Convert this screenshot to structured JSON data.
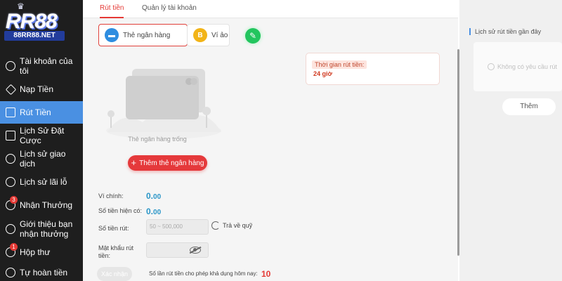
{
  "brand": {
    "logo_text": "RR88",
    "site": "88RR88.NET"
  },
  "sidebar": {
    "items": [
      {
        "label": "Tài khoản của tôi",
        "icon": "account-icon"
      },
      {
        "label": "Nạp Tiền",
        "icon": "deposit-icon"
      },
      {
        "label": "Rút Tiền",
        "icon": "withdraw-icon",
        "active": true
      },
      {
        "label": "Lịch Sử Đặt Cược",
        "icon": "bet-history-icon"
      },
      {
        "label": "Lịch sử giao dịch",
        "icon": "transaction-history-icon"
      },
      {
        "label": "Lịch sử lãi lỗ",
        "icon": "profit-loss-icon"
      },
      {
        "label": "Nhận Thưởng",
        "icon": "reward-icon",
        "badge": "3"
      },
      {
        "label": "Giới thiệu bạn nhận thưởng",
        "icon": "referral-icon"
      },
      {
        "label": "Hộp thư",
        "icon": "mailbox-icon",
        "badge": "1"
      },
      {
        "label": "Tự hoàn tiền",
        "icon": "cashback-icon"
      }
    ]
  },
  "tabs": [
    {
      "label": "Rút tiền",
      "active": true
    },
    {
      "label": "Quản lý tài khoản",
      "active": false
    }
  ],
  "methods": {
    "bank": "Thẻ ngân hàng",
    "wallet": "Ví ảo",
    "wallet_icon_text": "B"
  },
  "empty_state": {
    "label": "Thẻ ngân hàng trống",
    "add_button": "Thêm thẻ ngân hàng"
  },
  "withdraw_time": {
    "label": "Thời gian rút tiền:",
    "value": "24 giờ"
  },
  "form": {
    "main_wallet_label": "Ví chính:",
    "main_wallet_value": "0.",
    "main_wallet_decimal": "00",
    "current_balance_label": "Số tiền hiện có:",
    "current_balance_value": "0.",
    "current_balance_decimal": "00",
    "amount_label": "Số tiền rút:",
    "amount_placeholder": "50 ~ 500,000",
    "refund_label": "Trả về quỹ",
    "password_label": "Mật khẩu rút tiền:",
    "confirm_button": "Xác nhận",
    "limit_label": "Số lần rút tiền cho phép khả dụng hôm nay:",
    "limit_value": "10"
  },
  "history": {
    "title": "Lịch sử rút tiền gần đây",
    "empty": "Không có yêu cầu rút",
    "more_button": "Thêm"
  },
  "colors": {
    "sidebar_bg": "#1e1e1e",
    "active_nav": "#4a90e2",
    "accent_red": "#e5393b",
    "value_blue": "#2a96c8"
  }
}
